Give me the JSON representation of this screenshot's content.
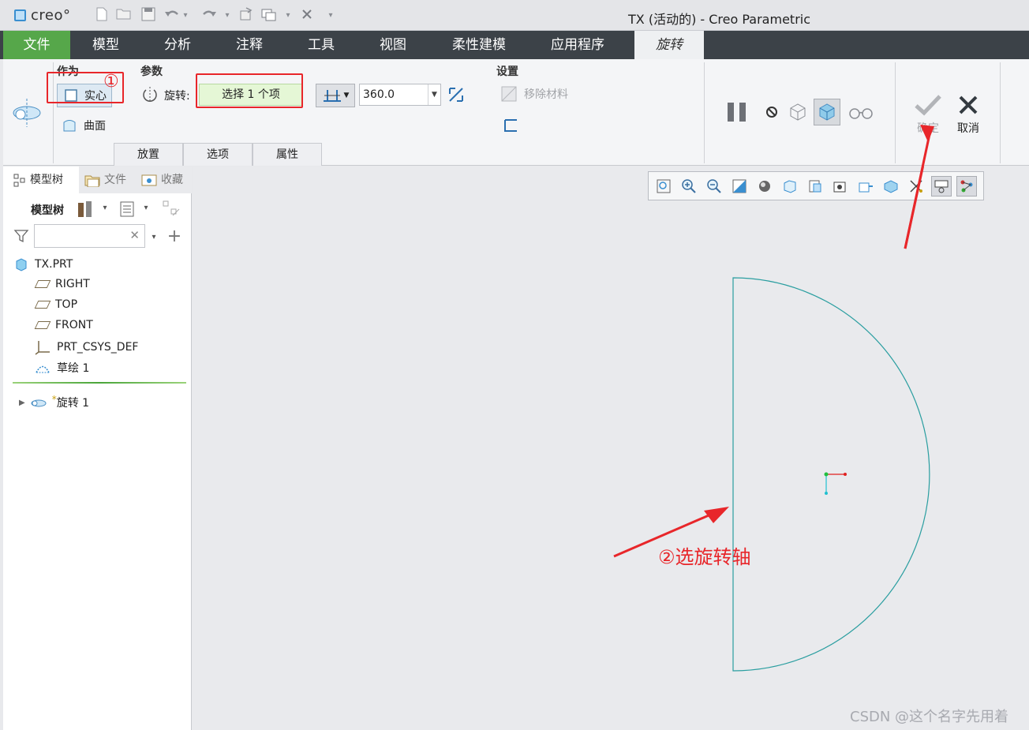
{
  "app": {
    "logo_text": "creo°",
    "window_title": "TX (活动的) - Creo Parametric"
  },
  "menu": {
    "tabs": [
      "文件",
      "模型",
      "分析",
      "注释",
      "工具",
      "视图",
      "柔性建模",
      "应用程序",
      "旋转"
    ],
    "active_tab": "旋转"
  },
  "ribbon": {
    "group_as": "作为",
    "solid_label": "实心",
    "surface_label": "曲面",
    "group_params": "参数",
    "rotate_label": "旋转:",
    "collector_text": "选择 1 个项",
    "angle_value": "360.0",
    "group_settings": "设置",
    "remove_material_label": "移除材料",
    "ok_label": "确定",
    "cancel_label": "取消",
    "subtabs": [
      "放置",
      "选项",
      "属性"
    ]
  },
  "left_panel": {
    "tabs": [
      "模型树",
      "文件",
      "收藏"
    ],
    "tree_label": "模型树",
    "tree_items": [
      {
        "label": "TX.PRT",
        "icon": "part-icon"
      },
      {
        "label": "RIGHT",
        "icon": "datum-plane-icon"
      },
      {
        "label": "TOP",
        "icon": "datum-plane-icon"
      },
      {
        "label": "FRONT",
        "icon": "datum-plane-icon"
      },
      {
        "label": "PRT_CSYS_DEF",
        "icon": "csys-icon"
      },
      {
        "label": "草绘 1",
        "icon": "sketch-icon"
      }
    ],
    "insert_item": {
      "label": "旋转 1",
      "icon": "revolve-icon"
    }
  },
  "annotations": {
    "marker_1": "①",
    "marker_2_text": "②选旋转轴",
    "accent_color": "#e8262a"
  },
  "watermark": "CSDN @这个名字先用着",
  "colors": {
    "sketch_line": "#2a9ea0",
    "file_tab": "#56a74a",
    "menubar": "#3c4248",
    "collector_bg": "#e5f7d6"
  }
}
